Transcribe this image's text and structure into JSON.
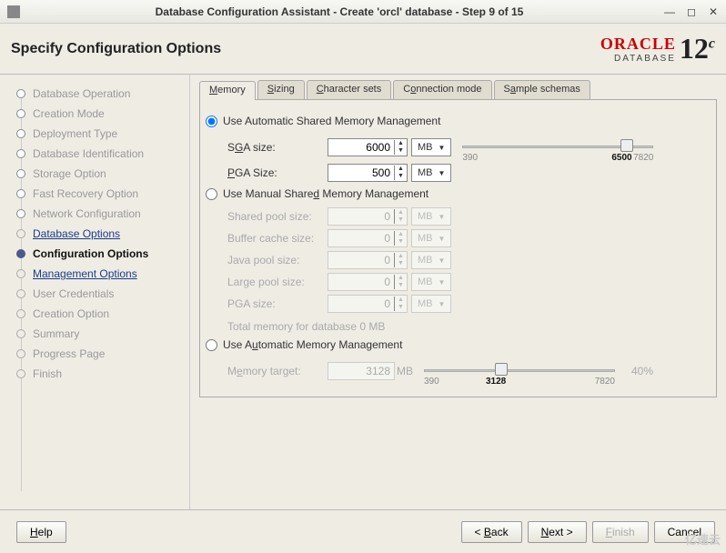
{
  "window": {
    "title": "Database Configuration Assistant - Create 'orcl' database - Step 9 of 15"
  },
  "header": {
    "title": "Specify Configuration Options",
    "brand": "ORACLE",
    "brand_sub": "DATABASE",
    "version": "12",
    "version_sup": "c"
  },
  "sidebar": {
    "steps": [
      {
        "label": "Database Operation",
        "state": "done"
      },
      {
        "label": "Creation Mode",
        "state": "done"
      },
      {
        "label": "Deployment Type",
        "state": "done"
      },
      {
        "label": "Database Identification",
        "state": "done"
      },
      {
        "label": "Storage Option",
        "state": "done"
      },
      {
        "label": "Fast Recovery Option",
        "state": "done"
      },
      {
        "label": "Network Configuration",
        "state": "done"
      },
      {
        "label": "Database Options",
        "state": "link"
      },
      {
        "label": "Configuration Options",
        "state": "current"
      },
      {
        "label": "Management Options",
        "state": "link"
      },
      {
        "label": "User Credentials",
        "state": "future"
      },
      {
        "label": "Creation Option",
        "state": "future"
      },
      {
        "label": "Summary",
        "state": "future"
      },
      {
        "label": "Progress Page",
        "state": "future"
      },
      {
        "label": "Finish",
        "state": "future"
      }
    ]
  },
  "tabs": {
    "memory": "Memory",
    "sizing": "Sizing",
    "charsets": "Character sets",
    "connmode": "Connection mode",
    "sample": "Sample schemas"
  },
  "memory": {
    "auto_shared": {
      "label": "Use Automatic Shared Memory Management",
      "checked": true
    },
    "sga": {
      "label": "SGA size:",
      "value": "6000",
      "unit": "MB"
    },
    "pga": {
      "label": "PGA Size:",
      "value": "500",
      "unit": "MB"
    },
    "slider": {
      "min": "390",
      "val": "6500",
      "max": "7820"
    },
    "manual": {
      "label": "Use Manual Shared Memory Management",
      "checked": false
    },
    "manual_rows": [
      {
        "label": "Shared pool size:",
        "value": "0",
        "unit": "MB"
      },
      {
        "label": "Buffer cache size:",
        "value": "0",
        "unit": "MB"
      },
      {
        "label": "Java pool size:",
        "value": "0",
        "unit": "MB"
      },
      {
        "label": "Large pool size:",
        "value": "0",
        "unit": "MB"
      },
      {
        "label": "PGA size:",
        "value": "0",
        "unit": "MB"
      }
    ],
    "total": "Total memory for database 0 MB",
    "auto": {
      "label": "Use Automatic Memory Management",
      "checked": false
    },
    "target": {
      "label": "Memory target:",
      "value": "3128",
      "unit": "MB",
      "pct": "40%"
    },
    "target_slider": {
      "min": "390",
      "val": "3128",
      "max": "7820"
    }
  },
  "buttons": {
    "help": "Help",
    "back": "< Back",
    "next": "Next >",
    "finish": "Finish",
    "cancel": "Cancel"
  },
  "watermark": "亿速云"
}
